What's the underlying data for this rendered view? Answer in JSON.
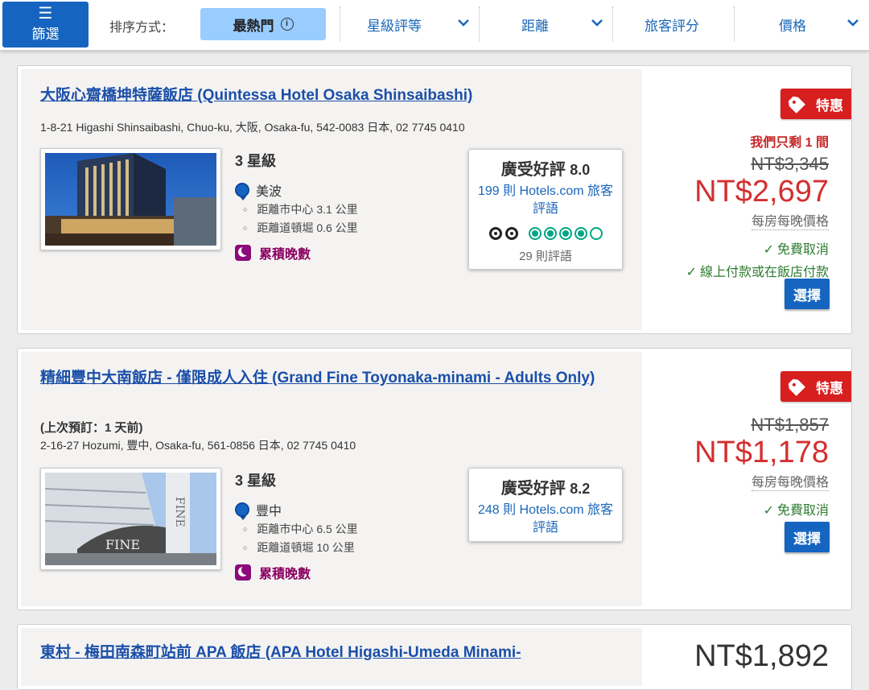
{
  "filter_button": {
    "label": "篩選"
  },
  "sort": {
    "label": "排序方式：",
    "options": [
      {
        "label": "最熱門",
        "active": true
      },
      {
        "label": "星級評等"
      },
      {
        "label": "距離"
      },
      {
        "label": "旅客評分"
      },
      {
        "label": "價格"
      }
    ]
  },
  "colors": {
    "accent": "#1565c0",
    "price_red": "#d32f2f",
    "deal_red": "#d71f1f",
    "perk_green": "#2e7d32",
    "link": "#1a4fa8"
  },
  "hotels": [
    {
      "name": "大阪心齋橋坤特薩飯店 (Quintessa Hotel Osaka Shinsaibashi)",
      "address": "1-8-21 Higashi Shinsaibashi, Chuo-ku, 大阪, Osaka-fu, 542-0083 日本, 02 7745 0410",
      "stars": "3 星級",
      "area": "美波",
      "distances": [
        "距離市中心 3.1 公里",
        "距離道頓堀 0.6 公里"
      ],
      "rewards": "累積晚數",
      "review_label": "廣受好評",
      "review_score": "8.0",
      "review_link": "199 則 Hotels.com 旅客評語",
      "tripadvisor_count": "29 則評語",
      "tripadvisor_rating": 4.5,
      "deal": "特惠",
      "rooms_left": "我們只剩 1 間",
      "old_price": "NT$3,345",
      "price": "NT$2,697",
      "per_night": "每房每晚價格",
      "perks": [
        "免費取消",
        "線上付款或在飯店付款"
      ],
      "select": "選擇"
    },
    {
      "name": "精細豐中大南飯店 - 僅限成人入住 (Grand Fine Toyonaka-minami - Adults Only)",
      "last_booked": "(上次預訂：1 天前)",
      "address": "2-16-27 Hozumi, 豐中, Osaka-fu, 561-0856 日本, 02 7745 0410",
      "stars": "3 星級",
      "area": "豐中",
      "distances": [
        "距離市中心 6.5 公里",
        "距離道頓堀 10 公里"
      ],
      "rewards": "累積晚數",
      "review_label": "廣受好評",
      "review_score": "8.2",
      "review_link": "248 則 Hotels.com 旅客評語",
      "deal": "特惠",
      "old_price": "NT$1,857",
      "price": "NT$1,178",
      "per_night": "每房每晚價格",
      "perks": [
        "免費取消"
      ],
      "select": "選擇"
    },
    {
      "name": "東村 - 梅田南森町站前 APA 飯店 (APA Hotel Higashi-Umeda Minami-",
      "price": "NT$1,892"
    }
  ]
}
